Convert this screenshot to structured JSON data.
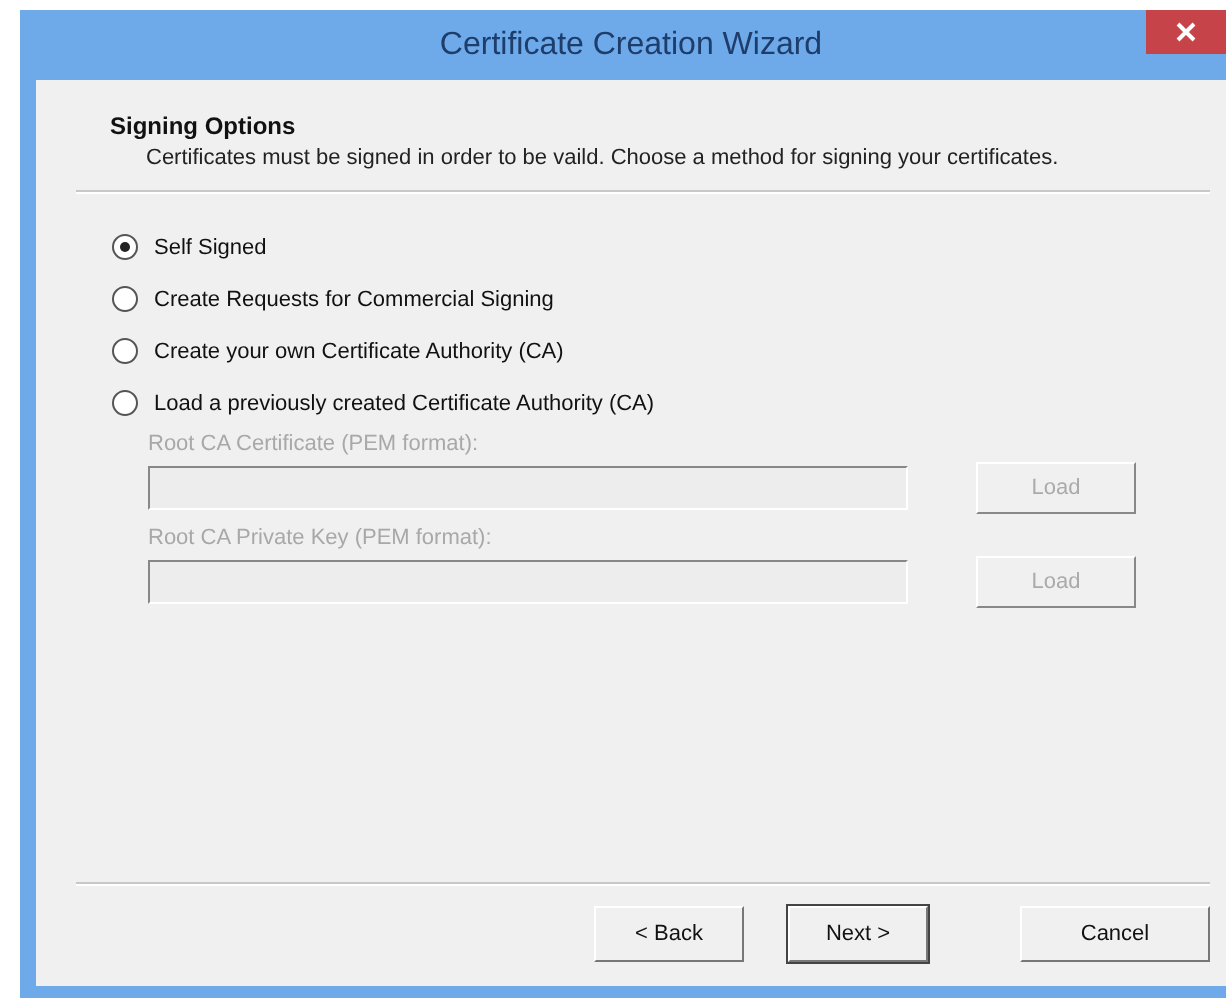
{
  "window": {
    "title": "Certificate Creation Wizard"
  },
  "header": {
    "title": "Signing Options",
    "subtitle": "Certificates must be signed in order to be vaild.  Choose a method for signing your certificates."
  },
  "options": [
    {
      "label": "Self Signed",
      "selected": true
    },
    {
      "label": "Create Requests for Commercial Signing",
      "selected": false
    },
    {
      "label": "Create your own Certificate Authority (CA)",
      "selected": false
    },
    {
      "label": "Load a previously created Certificate Authority (CA)",
      "selected": false
    }
  ],
  "fields": [
    {
      "label": "Root CA Certificate (PEM format):",
      "button": "Load",
      "disabled": true
    },
    {
      "label": "Root CA Private Key (PEM format):",
      "button": "Load",
      "disabled": true
    }
  ],
  "buttons": [
    {
      "label": "< Back",
      "default": false
    },
    {
      "label": "Next >",
      "default": true
    },
    {
      "label": "Cancel",
      "default": false
    }
  ]
}
